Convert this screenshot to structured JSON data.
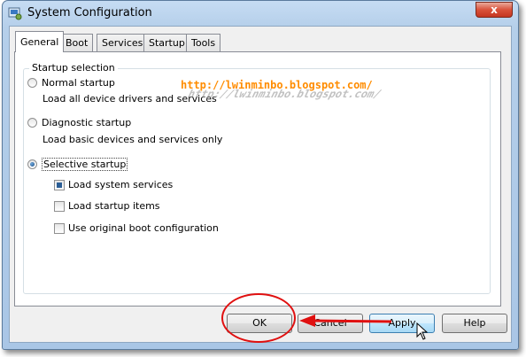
{
  "window": {
    "title": "System Configuration",
    "close_label": "x"
  },
  "tabs": [
    {
      "label": "General",
      "active": true
    },
    {
      "label": "Boot",
      "active": false
    },
    {
      "label": "Services",
      "active": false
    },
    {
      "label": "Startup",
      "active": false
    },
    {
      "label": "Tools",
      "active": false
    }
  ],
  "startup_selection": {
    "legend": "Startup selection",
    "normal": {
      "label": "Normal startup",
      "desc": "Load all device drivers and services",
      "checked": false
    },
    "diagnostic": {
      "label": "Diagnostic startup",
      "desc": "Load basic devices and services only",
      "checked": false
    },
    "selective": {
      "label": "Selective startup",
      "checked": true
    },
    "options": [
      {
        "label": "Load system services",
        "state": "indeterminate"
      },
      {
        "label": "Load startup items",
        "state": "unchecked"
      },
      {
        "label": "Use original boot configuration",
        "state": "unchecked"
      }
    ]
  },
  "buttons": {
    "ok": "OK",
    "cancel": "Cancel",
    "apply": "Apply",
    "help": "Help"
  },
  "watermark": "http://lwinminbo.blogspot.com/",
  "colors": {
    "annotation": "#e01010",
    "watermark": "#ff8c00"
  }
}
